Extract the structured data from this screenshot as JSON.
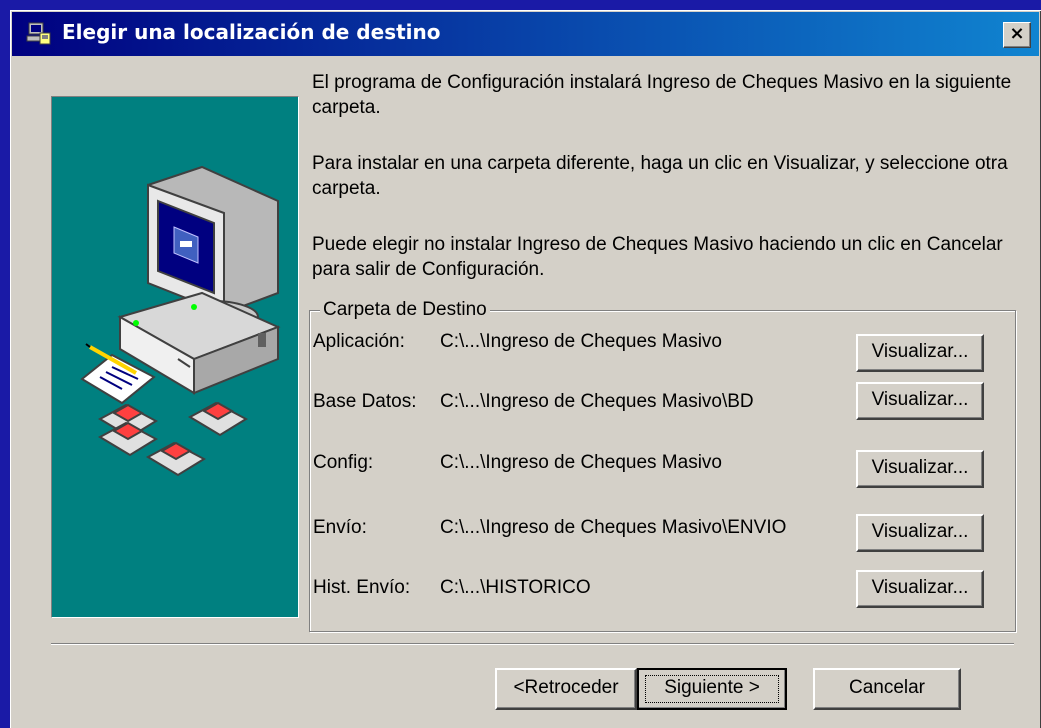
{
  "window": {
    "title": "Elegir una localización de destino",
    "close_label": "×"
  },
  "intro": {
    "p1": "El programa de Configuración instalará Ingreso de Cheques Masivo en la siguiente carpeta.",
    "p2": "Para instalar en una carpeta diferente, haga un clic en Visualizar, y seleccione otra carpeta.",
    "p3": "Puede elegir no instalar Ingreso de Cheques Masivo haciendo un clic en Cancelar para salir de Configuración."
  },
  "destination": {
    "legend": "Carpeta de Destino",
    "rows": [
      {
        "label": "Aplicación:",
        "path": "C:\\...\\Ingreso de Cheques Masivo",
        "button": "Visualizar..."
      },
      {
        "label": "Base Datos:",
        "path": "C:\\...\\Ingreso de Cheques Masivo\\BD",
        "button": "Visualizar..."
      },
      {
        "label": "Config:",
        "path": "C:\\...\\Ingreso de Cheques Masivo",
        "button": "Visualizar..."
      },
      {
        "label": "Envío:",
        "path": "C:\\...\\Ingreso de Cheques Masivo\\ENVIO",
        "button": "Visualizar..."
      },
      {
        "label": "Hist. Envío:",
        "path": "C:\\...\\HISTORICO",
        "button": "Visualizar..."
      }
    ]
  },
  "buttons": {
    "back": "<Retroceder",
    "next": "Siguiente >",
    "cancel": "Cancelar"
  },
  "colors": {
    "title_gradient_start": "#000080",
    "title_gradient_end": "#1084d0",
    "dialog_face": "#d4d0c8",
    "illustration_bg": "#008080",
    "desktop_border": "#1a1aa6"
  }
}
